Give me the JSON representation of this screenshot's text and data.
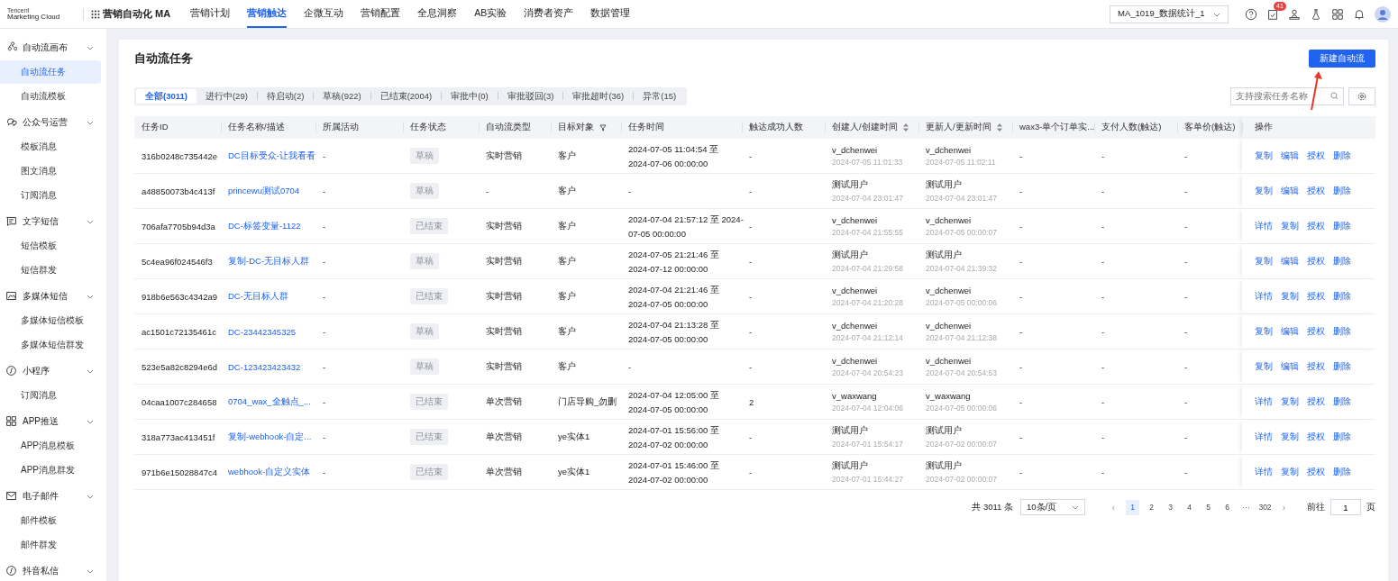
{
  "topbar": {
    "logo_small": "Tencent",
    "logo": "Marketing Cloud",
    "product": "营销自动化 MA",
    "nav": [
      {
        "label": "营销计划",
        "selected": false
      },
      {
        "label": "营销触达",
        "selected": true
      },
      {
        "label": "企微互动",
        "selected": false
      },
      {
        "label": "营销配置",
        "selected": false
      },
      {
        "label": "全息洞察",
        "selected": false
      },
      {
        "label": "AB实验",
        "selected": false
      },
      {
        "label": "消费者资产",
        "selected": false
      },
      {
        "label": "数据管理",
        "selected": false
      }
    ],
    "account": "MA_1019_数据统计_1",
    "badge": "41"
  },
  "sidebar": {
    "groups": [
      {
        "label": "自动流画布",
        "expanded": true,
        "children": [
          {
            "label": "自动流任务",
            "selected": true
          },
          {
            "label": "自动流模板",
            "selected": false
          }
        ]
      },
      {
        "label": "公众号运营",
        "expanded": true,
        "children": [
          {
            "label": "模板消息",
            "selected": false
          },
          {
            "label": "图文消息",
            "selected": false
          },
          {
            "label": "订阅消息",
            "selected": false
          }
        ]
      },
      {
        "label": "文字短信",
        "expanded": true,
        "children": [
          {
            "label": "短信模板",
            "selected": false
          },
          {
            "label": "短信群发",
            "selected": false
          }
        ]
      },
      {
        "label": "多媒体短信",
        "expanded": true,
        "children": [
          {
            "label": "多媒体短信模板",
            "selected": false
          },
          {
            "label": "多媒体短信群发",
            "selected": false
          }
        ]
      },
      {
        "label": "小程序",
        "expanded": true,
        "children": [
          {
            "label": "订阅消息",
            "selected": false
          }
        ]
      },
      {
        "label": "APP推送",
        "expanded": true,
        "children": [
          {
            "label": "APP消息模板",
            "selected": false
          },
          {
            "label": "APP消息群发",
            "selected": false
          }
        ]
      },
      {
        "label": "电子邮件",
        "expanded": true,
        "children": [
          {
            "label": "邮件模板",
            "selected": false
          },
          {
            "label": "邮件群发",
            "selected": false
          }
        ]
      },
      {
        "label": "抖音私信",
        "expanded": true
      }
    ]
  },
  "page": {
    "title": "自动流任务",
    "create_button": "新建自动流",
    "search": {
      "placeholder": "支持搜索任务名称"
    },
    "tabs": [
      {
        "label": "全部(3011)",
        "selected": true
      },
      {
        "label": "进行中(29)",
        "selected": false
      },
      {
        "label": "待启动(2)",
        "selected": false
      },
      {
        "label": "草稿(922)",
        "selected": false
      },
      {
        "label": "已结束(2004)",
        "selected": false
      },
      {
        "label": "审批中(0)",
        "selected": false
      },
      {
        "label": "审批驳回(3)",
        "selected": false
      },
      {
        "label": "审批超时(36)",
        "selected": false
      },
      {
        "label": "异常(15)",
        "selected": false
      }
    ]
  },
  "table": {
    "columns": [
      {
        "label": "任务ID",
        "kind": "plain"
      },
      {
        "label": "任务名称/描述",
        "kind": "plain"
      },
      {
        "label": "所属活动",
        "kind": "plain"
      },
      {
        "label": "任务状态",
        "kind": "plain"
      },
      {
        "label": "自动流类型",
        "kind": "plain"
      },
      {
        "label": "目标对象",
        "kind": "filter"
      },
      {
        "label": "任务时间",
        "kind": "plain"
      },
      {
        "label": "触达成功人数",
        "kind": "plain"
      },
      {
        "label": "创建人/创建时间",
        "kind": "sort"
      },
      {
        "label": "更新人/更新时间",
        "kind": "sort"
      },
      {
        "label": "wax3-单个订单实...",
        "kind": "plain"
      },
      {
        "label": "支付人数(触达)",
        "kind": "plain"
      },
      {
        "label": "客单价(触达)",
        "kind": "plain"
      },
      {
        "label": "操作",
        "kind": "plain"
      }
    ],
    "rows": [
      {
        "id": "316b0248c735442e",
        "name": "DC目标受众-让我看看",
        "activity": "-",
        "status": "草稿",
        "type": "实时营销",
        "target": "客户",
        "time": [
          "2024-07-05 11:04:54 至",
          "2024-07-06 00:00:00"
        ],
        "reached": "-",
        "creator": "v_dchenwei",
        "created": "2024-07-05 11:01:33",
        "updater": "v_dchenwei",
        "updated": "2024-07-05 11:02:11",
        "wax3": "-",
        "paid": "-",
        "price": "-",
        "actions": [
          "复制",
          "编辑",
          "授权",
          "删除"
        ]
      },
      {
        "id": "a48850073b4c413f",
        "name": "princewu测试0704",
        "activity": "-",
        "status": "草稿",
        "type": "-",
        "target": "客户",
        "time": [
          "-"
        ],
        "reached": "-",
        "creator": "测试用户",
        "created": "2024-07-04 23:01:47",
        "updater": "测试用户",
        "updated": "2024-07-04 23:01:47",
        "wax3": "-",
        "paid": "-",
        "price": "-",
        "actions": [
          "复制",
          "编辑",
          "授权",
          "删除"
        ]
      },
      {
        "id": "706afa7705b94d3a",
        "name": "DC-标签变量-1122",
        "activity": "-",
        "status": "已结束",
        "type": "实时营销",
        "target": "客户",
        "time": [
          "2024-07-04 21:57:12 至 2024-",
          "07-05 00:00:00"
        ],
        "reached": "-",
        "creator": "v_dchenwei",
        "created": "2024-07-04 21:55:55",
        "updater": "v_dchenwei",
        "updated": "2024-07-05 00:00:07",
        "wax3": "-",
        "paid": "-",
        "price": "-",
        "actions": [
          "详情",
          "复制",
          "授权",
          "删除"
        ]
      },
      {
        "id": "5c4ea96f024546f3",
        "name": "复制-DC-无目标人群",
        "activity": "-",
        "status": "草稿",
        "type": "实时营销",
        "target": "客户",
        "time": [
          "2024-07-05 21:21:46 至",
          "2024-07-12 00:00:00"
        ],
        "reached": "-",
        "creator": "测试用户",
        "created": "2024-07-04 21:29:58",
        "updater": "测试用户",
        "updated": "2024-07-04 21:39:32",
        "wax3": "-",
        "paid": "-",
        "price": "-",
        "actions": [
          "复制",
          "编辑",
          "授权",
          "删除"
        ]
      },
      {
        "id": "918b6e563c4342a9",
        "name": "DC-无目标人群",
        "activity": "-",
        "status": "已结束",
        "type": "实时营销",
        "target": "客户",
        "time": [
          "2024-07-04 21:21:46 至",
          "2024-07-05 00:00:00"
        ],
        "reached": "-",
        "creator": "v_dchenwei",
        "created": "2024-07-04 21:20:28",
        "updater": "v_dchenwei",
        "updated": "2024-07-05 00:00:06",
        "wax3": "-",
        "paid": "-",
        "price": "-",
        "actions": [
          "详情",
          "复制",
          "授权",
          "删除"
        ]
      },
      {
        "id": "ac1501c72135461c",
        "name": "DC-23442345325",
        "activity": "-",
        "status": "草稿",
        "type": "实时营销",
        "target": "客户",
        "time": [
          "2024-07-04 21:13:28 至",
          "2024-07-05 00:00:00"
        ],
        "reached": "-",
        "creator": "v_dchenwei",
        "created": "2024-07-04 21:12:14",
        "updater": "v_dchenwei",
        "updated": "2024-07-04 21:12:38",
        "wax3": "-",
        "paid": "-",
        "price": "-",
        "actions": [
          "复制",
          "编辑",
          "授权",
          "删除"
        ]
      },
      {
        "id": "523e5a82c8294e6d",
        "name": "DC-123423423432",
        "activity": "-",
        "status": "草稿",
        "type": "实时营销",
        "target": "客户",
        "time": [
          "-"
        ],
        "reached": "-",
        "creator": "v_dchenwei",
        "created": "2024-07-04 20:54:23",
        "updater": "v_dchenwei",
        "updated": "2024-07-04 20:54:53",
        "wax3": "-",
        "paid": "-",
        "price": "-",
        "actions": [
          "复制",
          "编辑",
          "授权",
          "删除"
        ]
      },
      {
        "id": "04caa1007c284658",
        "name": "0704_wax_全触点_...",
        "activity": "-",
        "status": "已结束",
        "type": "单次营销",
        "target": "门店导购_勿删",
        "time": [
          "2024-07-04 12:05:00 至",
          "2024-07-05 00:00:00"
        ],
        "reached": "2",
        "creator": "v_waxwang",
        "created": "2024-07-04 12:04:06",
        "updater": "v_waxwang",
        "updated": "2024-07-05 00:00:06",
        "wax3": "-",
        "paid": "-",
        "price": "-",
        "actions": [
          "详情",
          "复制",
          "授权",
          "删除"
        ]
      },
      {
        "id": "318a773ac413451f",
        "name": "复制-webhook-自定...",
        "activity": "-",
        "status": "已结束",
        "type": "单次营销",
        "target": "ye实体1",
        "time": [
          "2024-07-01 15:56:00 至",
          "2024-07-02 00:00:00"
        ],
        "reached": "-",
        "creator": "测试用户",
        "created": "2024-07-01 15:54:17",
        "updater": "测试用户",
        "updated": "2024-07-02 00:00:07",
        "wax3": "-",
        "paid": "-",
        "price": "-",
        "actions": [
          "详情",
          "复制",
          "授权",
          "删除"
        ]
      },
      {
        "id": "971b6e15028847c4",
        "name": "webhook-自定义实体",
        "activity": "-",
        "status": "已结束",
        "type": "单次营销",
        "target": "ye实体1",
        "time": [
          "2024-07-01 15:46:00 至",
          "2024-07-02 00:00:00"
        ],
        "reached": "-",
        "creator": "测试用户",
        "created": "2024-07-01 15:44:27",
        "updater": "测试用户",
        "updated": "2024-07-02 00:00:07",
        "wax3": "-",
        "paid": "-",
        "price": "-",
        "actions": [
          "详情",
          "复制",
          "授权",
          "删除"
        ]
      }
    ]
  },
  "pagination": {
    "total": "共 3011 条",
    "page_size": "10条/页",
    "prev": "‹",
    "pages": [
      {
        "label": "1",
        "selected": true
      },
      {
        "label": "2",
        "selected": false
      },
      {
        "label": "3",
        "selected": false
      },
      {
        "label": "4",
        "selected": false
      },
      {
        "label": "5",
        "selected": false
      },
      {
        "label": "6",
        "selected": false
      },
      {
        "label": "···",
        "selected": false
      },
      {
        "label": "302",
        "selected": false
      }
    ],
    "next": "›",
    "goto_label": "前往",
    "goto_value": "1",
    "goto_unit": "页"
  }
}
